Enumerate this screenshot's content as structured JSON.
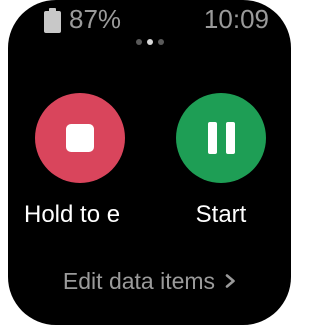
{
  "status": {
    "battery_percent": "87%",
    "battery_icon": "battery-icon",
    "time": "10:09"
  },
  "pager": {
    "total_pages": 3,
    "active_page": 2
  },
  "actions": {
    "stop": {
      "label": "Hold to e",
      "icon": "stop-icon",
      "color": "#d9455c"
    },
    "pause": {
      "label": "Start",
      "icon": "pause-icon",
      "color": "#1e9e55"
    }
  },
  "footer": {
    "edit_label": "Edit data items",
    "chevron_icon": "chevron-right-icon"
  }
}
